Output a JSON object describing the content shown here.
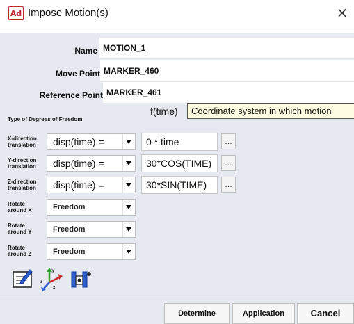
{
  "window": {
    "app_icon": "Ad",
    "title": "Impose Motion(s)",
    "close_glyph": "×"
  },
  "fields": {
    "name_label": "Name",
    "name_value": "MOTION_1",
    "move_point_label": "Move Point",
    "move_point_value": "MARKER_460",
    "reference_point_label": "Reference Point",
    "reference_point_value": "MARKER_461"
  },
  "dof": {
    "header_label": "Type of Degrees of Freedom",
    "ftime_label": "f(time)",
    "tooltip": "Coordinate system in which motion",
    "rows": [
      {
        "label_line1": "X-direction",
        "label_line2": "translation",
        "select": "disp(time) =",
        "expr": "0 * time",
        "button": "..."
      },
      {
        "label_line1": "Y-direction",
        "label_line2": "translation",
        "select": "disp(time) =",
        "expr": "30*COS(TIME)",
        "button": "..."
      },
      {
        "label_line1": "Z-direction",
        "label_line2": "translation",
        "select": "disp(time) =",
        "expr": "30*SIN(TIME)",
        "button": "..."
      },
      {
        "label_line1": "Rotate",
        "label_line2": "around X",
        "select": "Freedom"
      },
      {
        "label_line1": "Rotate",
        "label_line2": "around Y",
        "select": "Freedom"
      },
      {
        "label_line1": "Rotate",
        "label_line2": "around Z",
        "select": "Freedom"
      }
    ]
  },
  "toolbar_icons": [
    "edit-form-icon",
    "coordinate-axes-icon",
    "joint-motion-icon"
  ],
  "buttons": {
    "determine": "Determine",
    "application": "Application",
    "cancel": "Cancel"
  },
  "colors": {
    "dialog_bg": "#e6e9f0",
    "app_icon_red": "#c1272d",
    "tooltip_bg": "#fffde2"
  }
}
